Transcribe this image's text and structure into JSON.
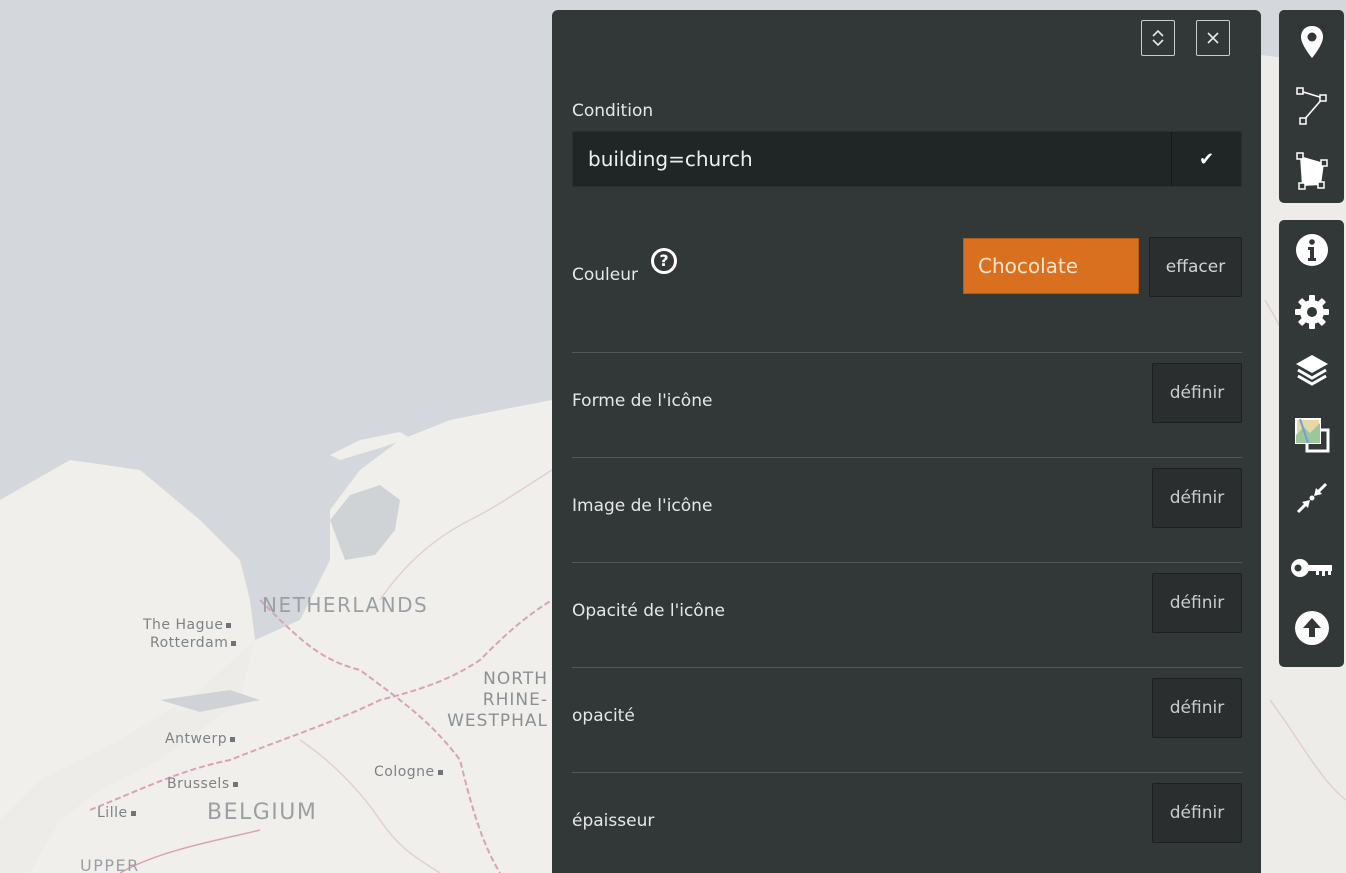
{
  "map": {
    "cities": [
      "The Hague",
      "Rotterdam",
      "Antwerp",
      "Brussels",
      "Cologne",
      "Lille"
    ],
    "countries": [
      "NETHERLANDS",
      "BELGIUM",
      "UPPER"
    ],
    "region_lines": [
      "NORTH",
      "RHINE-",
      "WESTPHAL"
    ]
  },
  "panel": {
    "condition_label": "Condition",
    "condition_value": "building=church",
    "color_label": "Couleur",
    "color_value": "Chocolate",
    "color_hex": "#d9701f",
    "clear_label": "effacer",
    "properties": [
      {
        "label": "Forme de l'icône",
        "button": "définir"
      },
      {
        "label": "Image de l'icône",
        "button": "définir"
      },
      {
        "label": "Opacité de l'icône",
        "button": "définir"
      },
      {
        "label": "opacité",
        "button": "définir"
      },
      {
        "label": "épaisseur",
        "button": "définir"
      }
    ]
  },
  "toolbars": {
    "draw": [
      "marker-icon",
      "polyline-icon",
      "polygon-icon"
    ],
    "tools": [
      "info-icon",
      "gear-icon",
      "layers-icon",
      "tilelayer-icon",
      "collapse-arrows-icon",
      "key-icon",
      "upload-icon"
    ]
  }
}
